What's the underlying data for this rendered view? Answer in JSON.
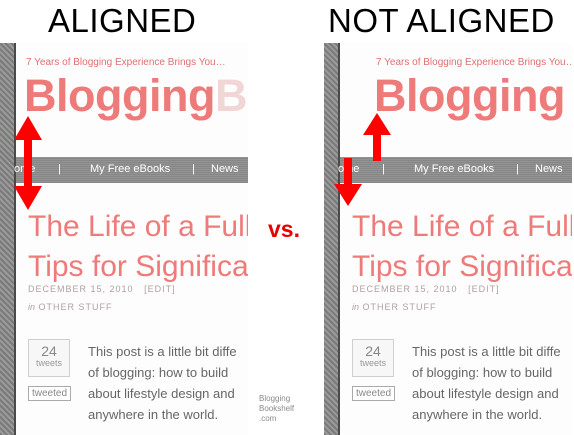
{
  "labels": {
    "left_heading": "ALIGNED",
    "right_heading": "NOT ALIGNED",
    "vs": "vs."
  },
  "blog": {
    "tagline": "7 Years of Blogging Experience Brings You…",
    "logo_main": "Blogging",
    "logo_tail": "B",
    "nav": [
      "ome",
      "|",
      "My Free eBooks",
      "|",
      "News"
    ],
    "post_title_lines": [
      "The Life of a Full",
      "Tips for Significa"
    ],
    "post_date": "DECEMBER 15, 2010",
    "post_edit": "[EDIT]",
    "post_category_prefix": "in",
    "post_category": "OTHER STUFF",
    "tweet_count": "24",
    "tweet_label": "tweets",
    "tweeted_button": "tweeted",
    "excerpt_lines": [
      "This post is a little bit diffe",
      "of blogging: how to build",
      "about lifestyle design and",
      "anywhere in the world."
    ]
  },
  "watermark": {
    "line1": "Blogging",
    "line2": "Bookshelf",
    "line3": ".com"
  },
  "colors": {
    "accent_pink": "#ee7a7a",
    "arrow_red": "#ff0000",
    "nav_gray": "#8c8c8c"
  }
}
